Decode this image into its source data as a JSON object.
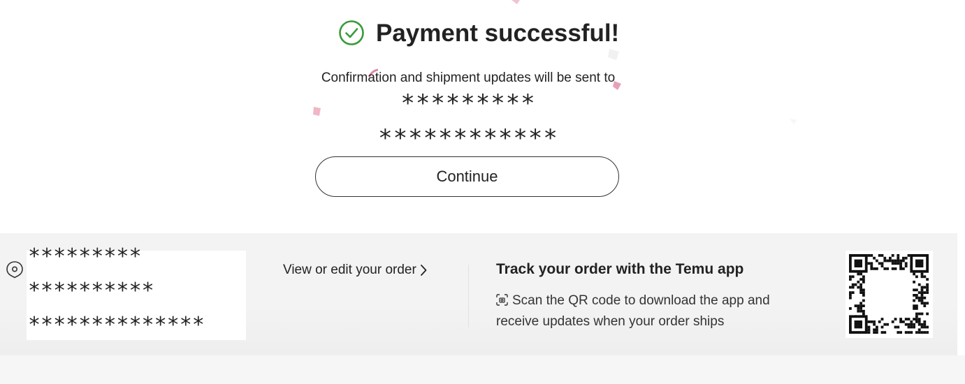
{
  "header": {
    "title": "Payment successful!",
    "check_icon": "check-circle-icon"
  },
  "confirmation": {
    "text": "Confirmation and shipment updates will be sent to",
    "masked_line_1": "*********",
    "masked_line_2": "************"
  },
  "actions": {
    "continue_label": "Continue"
  },
  "order_panel": {
    "location_icon": "location-icon",
    "address_lines": [
      "*********",
      "**********",
      "**************"
    ],
    "view_edit_label": "View or edit your order",
    "track_title": "Track your order with the Temu app",
    "scan_text": "Scan the QR code to download the app and receive updates when your order ships",
    "scan_icon": "scan-icon",
    "qr_icon": "qr-code-icon"
  },
  "colors": {
    "success_green": "#3a9a3a",
    "panel_bg": "#f3f3f3",
    "confetti_pink": "#e8a8b8"
  }
}
